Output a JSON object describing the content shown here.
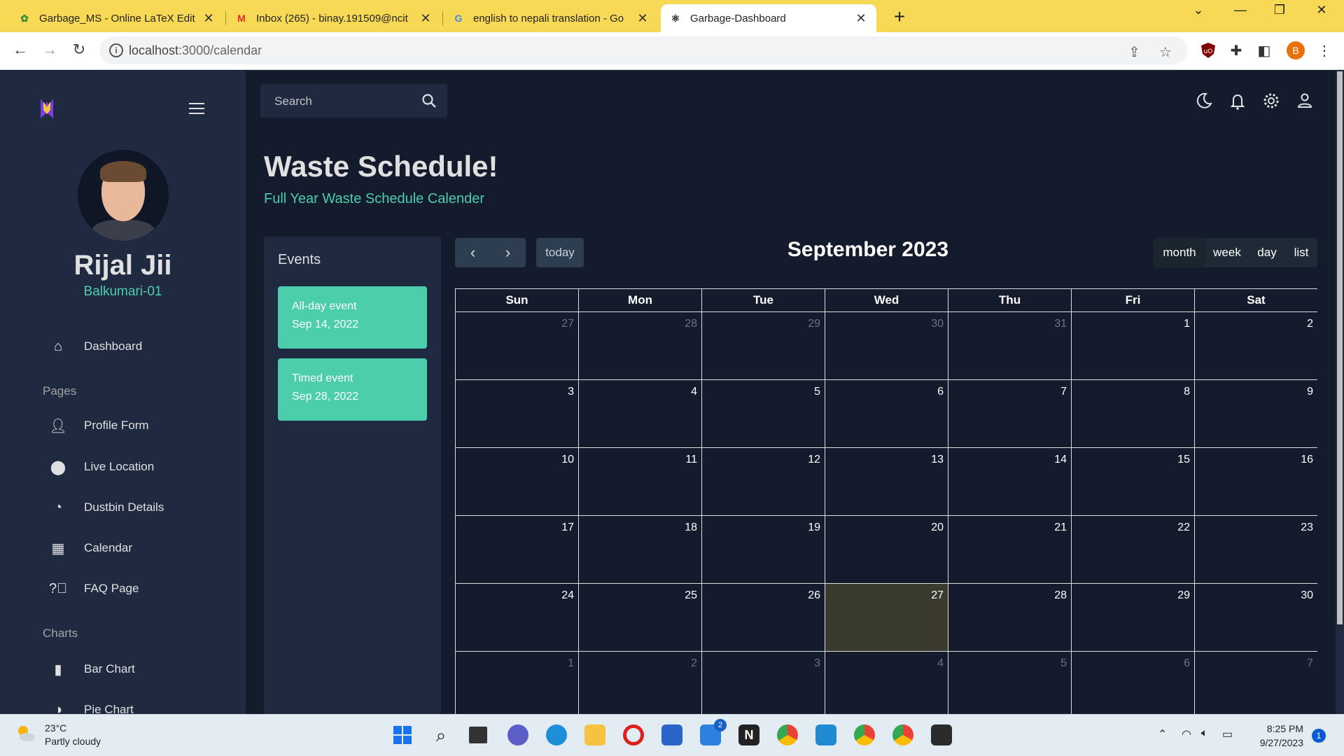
{
  "browser": {
    "tabs": [
      {
        "title": "Garbage_MS - Online LaTeX Edit",
        "icon": "overleaf-icon"
      },
      {
        "title": "Inbox (265) - binay.191509@ncit",
        "icon": "gmail-icon"
      },
      {
        "title": "english to nepali translation - Go",
        "icon": "google-icon"
      },
      {
        "title": "Garbage-Dashboard",
        "icon": "react-icon",
        "active": true
      }
    ],
    "url_host": "localhost",
    "url_path": ":3000/calendar",
    "profile_initial": "B"
  },
  "sidebar": {
    "user_name": "Rijal Jii",
    "user_location": "Balkumari-01",
    "dashboard": "Dashboard",
    "section_pages": "Pages",
    "pages": [
      "Profile Form",
      "Live Location",
      "Dustbin Details",
      "Calendar",
      "FAQ Page"
    ],
    "section_charts": "Charts",
    "charts": [
      "Bar Chart",
      "Pie Chart"
    ]
  },
  "topbar": {
    "search_placeholder": "Search"
  },
  "header": {
    "title": "Waste Schedule!",
    "subtitle": "Full Year Waste Schedule Calender"
  },
  "events": {
    "title": "Events",
    "items": [
      {
        "name": "All-day event",
        "date": "Sep 14, 2022"
      },
      {
        "name": "Timed event",
        "date": "Sep 28, 2022"
      }
    ]
  },
  "calendar": {
    "title": "September 2023",
    "today_label": "today",
    "views": [
      "month",
      "week",
      "day",
      "list"
    ],
    "active_view": "month",
    "weekdays": [
      "Sun",
      "Mon",
      "Tue",
      "Wed",
      "Thu",
      "Fri",
      "Sat"
    ],
    "weeks": [
      [
        "27",
        "28",
        "29",
        "30",
        "31",
        "1",
        "2"
      ],
      [
        "3",
        "4",
        "5",
        "6",
        "7",
        "8",
        "9"
      ],
      [
        "10",
        "11",
        "12",
        "13",
        "14",
        "15",
        "16"
      ],
      [
        "17",
        "18",
        "19",
        "20",
        "21",
        "22",
        "23"
      ],
      [
        "24",
        "25",
        "26",
        "27",
        "28",
        "29",
        "30"
      ],
      [
        "1",
        "2",
        "3",
        "4",
        "5",
        "6",
        "7"
      ]
    ],
    "today_cell": [
      4,
      3
    ],
    "colors": {
      "accent": "#4cceac",
      "panel": "#1f2a40",
      "bg": "#141b2d"
    }
  },
  "taskbar": {
    "temperature": "23°C",
    "weather": "Partly cloudy",
    "time": "8:25 PM",
    "date": "9/27/2023",
    "notifications": "1",
    "mail_badge": "2"
  }
}
